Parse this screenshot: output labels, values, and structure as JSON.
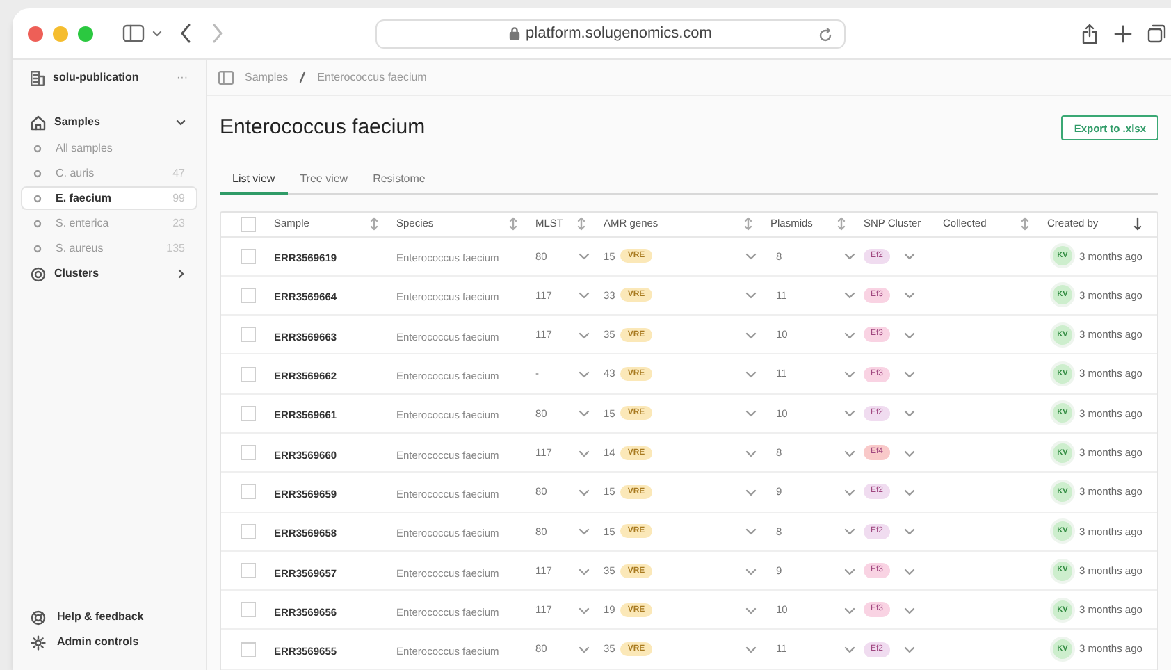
{
  "browser": {
    "url": "platform.solugenomics.com"
  },
  "sidebar": {
    "workspace": "solu-publication",
    "more": "···",
    "nav": [
      {
        "label": "Samples",
        "expanded": true,
        "children": [
          {
            "label": "All samples",
            "selected": false
          },
          {
            "label": "C. auris",
            "count": "47",
            "selected": false
          },
          {
            "label": "E. faecium",
            "count": "99",
            "selected": true
          },
          {
            "label": "S. enterica",
            "count": "23",
            "selected": false
          },
          {
            "label": "S. aureus",
            "count": "135",
            "selected": false
          }
        ]
      },
      {
        "label": "Clusters",
        "expanded": false
      }
    ],
    "footer": [
      {
        "label": "Help & feedback"
      },
      {
        "label": "Admin controls"
      }
    ]
  },
  "breadcrumb": [
    "Samples",
    "Enterococcus faecium"
  ],
  "page": {
    "title": "Enterococcus faecium",
    "export_button": "Export to .xlsx"
  },
  "tabs": [
    {
      "label": "List view",
      "selected": true
    },
    {
      "label": "Tree view",
      "selected": false
    },
    {
      "label": "Resistome",
      "selected": false
    }
  ],
  "table": {
    "all_checked": false,
    "columns": [
      {
        "label": "Sample",
        "kind": "sortable"
      },
      {
        "label": "Species",
        "kind": "sortable"
      },
      {
        "label": "MLST",
        "kind": "sortable"
      },
      {
        "label": "AMR genes",
        "kind": "sortable"
      },
      {
        "label": "Plasmids",
        "kind": "sortable"
      },
      {
        "label": "SNP Cluster",
        "kind": "plain"
      },
      {
        "label": "Collected",
        "kind": "sortable"
      },
      {
        "label": "Created by",
        "kind": "sorted"
      }
    ],
    "rows": [
      {
        "checked": false,
        "sample": "ERR3569619",
        "species": "Enterococcus faecium",
        "mlst": "80",
        "amr": "15",
        "amr_tag": "VRE",
        "plasmids": "8",
        "cluster": "Ef2",
        "color": "#f0dcf0",
        "creator": "KV",
        "created": "3 months ago"
      },
      {
        "checked": false,
        "sample": "ERR3569664",
        "species": "Enterococcus faecium",
        "mlst": "117",
        "amr": "33",
        "amr_tag": "VRE",
        "plasmids": "11",
        "cluster": "Ef3",
        "color": "#f9d3e3",
        "creator": "KV",
        "created": "3 months ago"
      },
      {
        "checked": false,
        "sample": "ERR3569663",
        "species": "Enterococcus faecium",
        "mlst": "117",
        "amr": "35",
        "amr_tag": "VRE",
        "plasmids": "10",
        "cluster": "Ef3",
        "color": "#f9d3e3",
        "creator": "KV",
        "created": "3 months ago"
      },
      {
        "checked": false,
        "sample": "ERR3569662",
        "species": "Enterococcus faecium",
        "mlst": "-",
        "amr": "43",
        "amr_tag": "VRE",
        "plasmids": "11",
        "cluster": "Ef3",
        "color": "#f9d3e3",
        "creator": "KV",
        "created": "3 months ago"
      },
      {
        "checked": false,
        "sample": "ERR3569661",
        "species": "Enterococcus faecium",
        "mlst": "80",
        "amr": "15",
        "amr_tag": "VRE",
        "plasmids": "10",
        "cluster": "Ef2",
        "color": "#f0dcf0",
        "creator": "KV",
        "created": "3 months ago"
      },
      {
        "checked": false,
        "sample": "ERR3569660",
        "species": "Enterococcus faecium",
        "mlst": "117",
        "amr": "14",
        "amr_tag": "VRE",
        "plasmids": "8",
        "cluster": "Ef4",
        "color": "#f9c9c9",
        "creator": "KV",
        "created": "3 months ago"
      },
      {
        "checked": false,
        "sample": "ERR3569659",
        "species": "Enterococcus faecium",
        "mlst": "80",
        "amr": "15",
        "amr_tag": "VRE",
        "plasmids": "9",
        "cluster": "Ef2",
        "color": "#f0dcf0",
        "creator": "KV",
        "created": "3 months ago"
      },
      {
        "checked": false,
        "sample": "ERR3569658",
        "species": "Enterococcus faecium",
        "mlst": "80",
        "amr": "15",
        "amr_tag": "VRE",
        "plasmids": "8",
        "cluster": "Ef2",
        "color": "#f0dcf0",
        "creator": "KV",
        "created": "3 months ago"
      },
      {
        "checked": false,
        "sample": "ERR3569657",
        "species": "Enterococcus faecium",
        "mlst": "117",
        "amr": "35",
        "amr_tag": "VRE",
        "plasmids": "9",
        "cluster": "Ef3",
        "color": "#f9d3e3",
        "creator": "KV",
        "created": "3 months ago"
      },
      {
        "checked": false,
        "sample": "ERR3569656",
        "species": "Enterococcus faecium",
        "mlst": "117",
        "amr": "19",
        "amr_tag": "VRE",
        "plasmids": "10",
        "cluster": "Ef3",
        "color": "#f9d3e3",
        "creator": "KV",
        "created": "3 months ago"
      },
      {
        "checked": false,
        "sample": "ERR3569655",
        "species": "Enterococcus faecium",
        "mlst": "80",
        "amr": "35",
        "amr_tag": "VRE",
        "plasmids": "11",
        "cluster": "Ef2",
        "color": "#f0dcf0",
        "creator": "KV",
        "created": "3 months ago"
      }
    ]
  }
}
